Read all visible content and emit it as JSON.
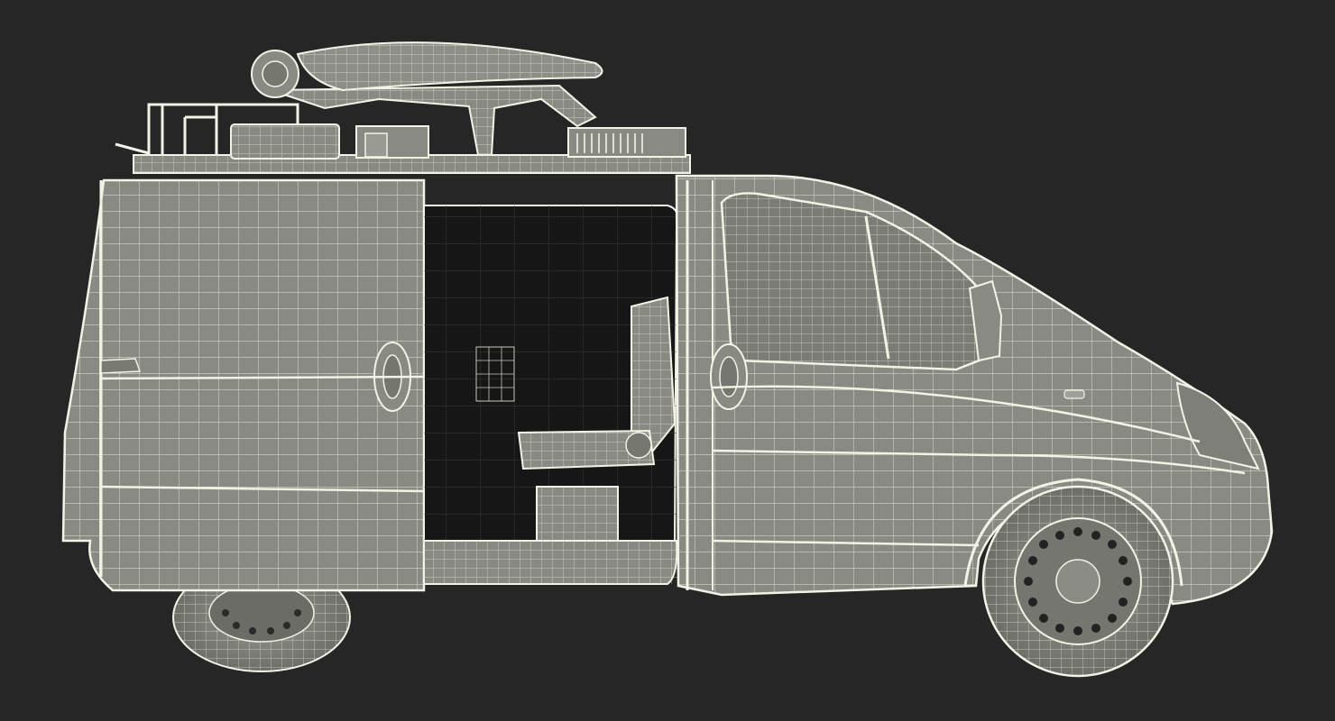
{
  "scene": {
    "subject": "van-wireframe-render",
    "background_color": "#262626",
    "body_fill": "#8a8a84",
    "body_dark": "#6f6f6a",
    "wire_color": "#f2f2e6",
    "interior_color": "#161616"
  }
}
